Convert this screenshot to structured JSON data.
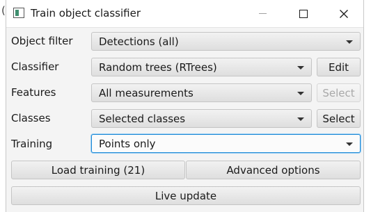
{
  "background_char": "(",
  "window": {
    "title": "Train object classifier"
  },
  "form": {
    "object_filter": {
      "label": "Object filter",
      "value": "Detections (all)"
    },
    "classifier": {
      "label": "Classifier",
      "value": "Random trees (RTrees)",
      "button": "Edit"
    },
    "features": {
      "label": "Features",
      "value": "All measurements",
      "button": "Select",
      "button_enabled": false
    },
    "classes": {
      "label": "Classes",
      "value": "Selected classes",
      "button": "Select"
    },
    "training": {
      "label": "Training",
      "value": "Points only"
    }
  },
  "actions": {
    "load_training": "Load training (21)",
    "advanced_options": "Advanced options",
    "live_update": "Live update"
  },
  "colors": {
    "focus_border": "#1e8ad6",
    "disabled_text": "#a8a8a8"
  }
}
